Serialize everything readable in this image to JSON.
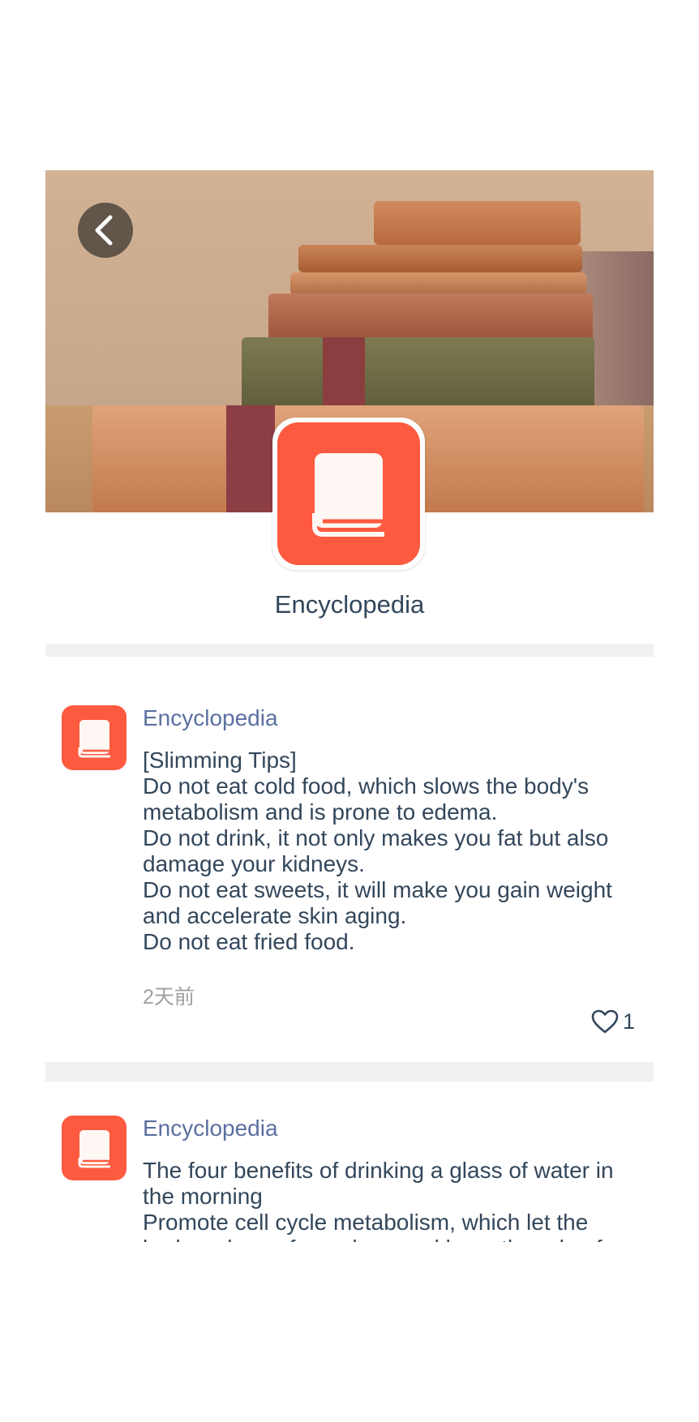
{
  "header": {
    "back_icon": "chevron-left-icon",
    "banner_image": "stack of antique books",
    "app_icon": "book-icon",
    "app_name": "Encyclopedia"
  },
  "colors": {
    "accent": "#fd5a3f",
    "author": "#5b6fa0",
    "text": "#33475b",
    "muted": "#a0a0a0",
    "separator": "#f1f1f1"
  },
  "posts": [
    {
      "author": "Encyclopedia",
      "lines": [
        "[Slimming Tips]",
        "Do not eat cold food, which slows the body's metabolism and is prone to edema.",
        "Do not drink, it not only makes you fat but also damage your kidneys.",
        "Do not eat sweets, it will make you gain weight and accelerate skin aging.",
        "Do not eat fried food."
      ],
      "time": "2天前",
      "likes": "1"
    },
    {
      "author": "Encyclopedia",
      "lines": [
        "The four benefits of drinking a glass of water in the morning",
        "Promote cell cycle metabolism, which let the body wake up from sleep and have the role of"
      ]
    }
  ]
}
